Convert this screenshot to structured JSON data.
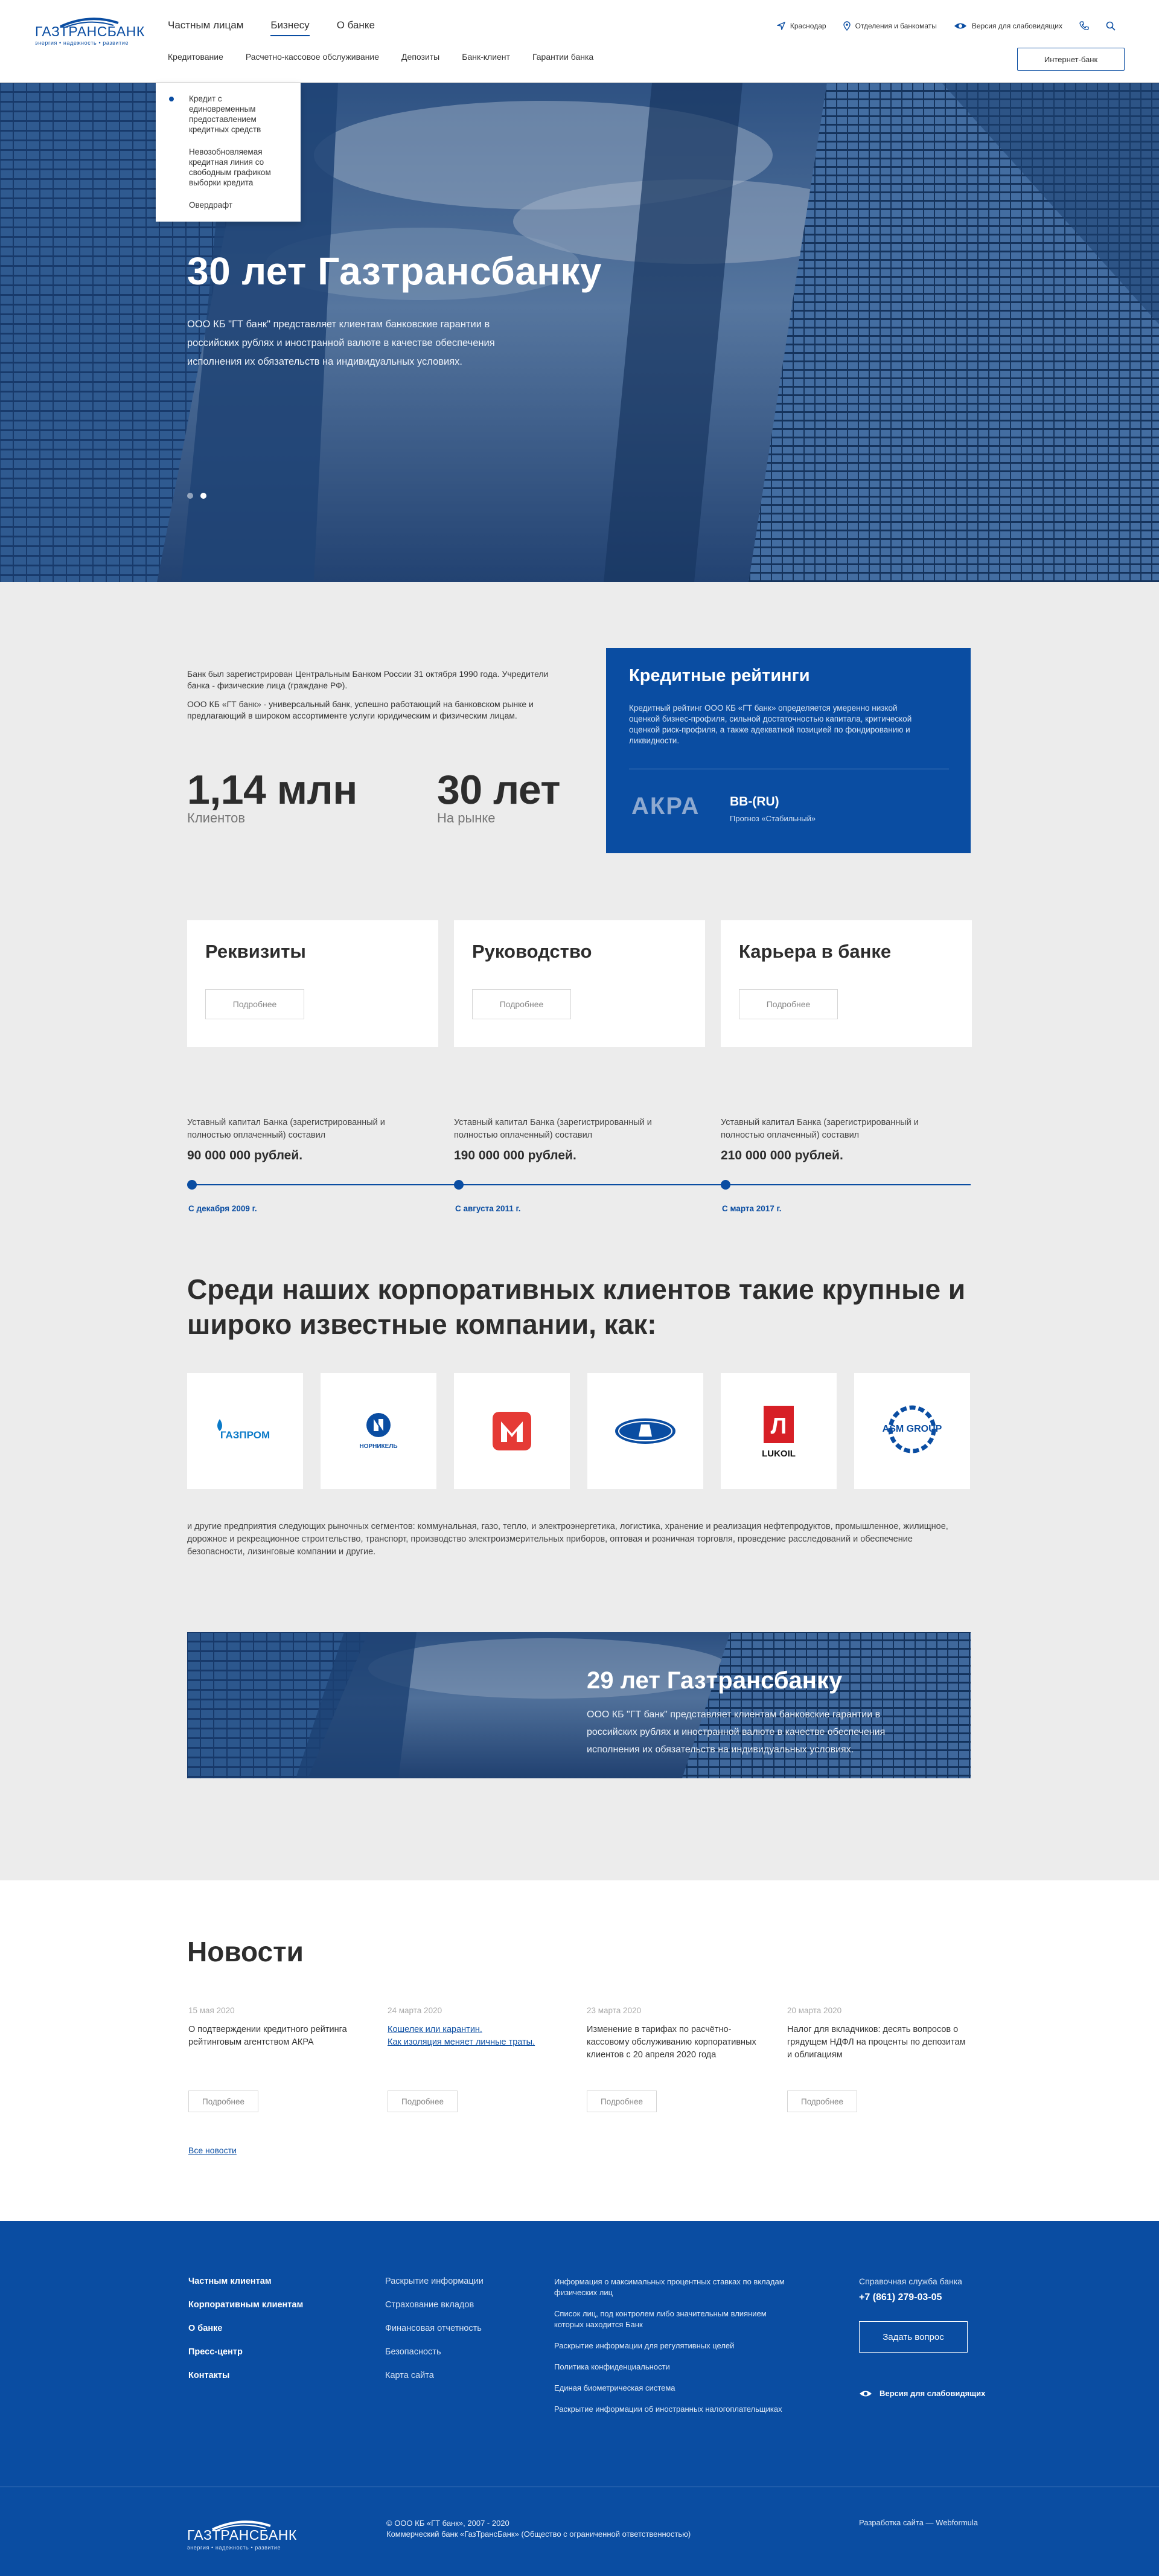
{
  "colors": {
    "brand_blue": "#0a4da2",
    "background": "#ececec"
  },
  "header": {
    "logo_name": "ГАЗТРАНСБАНК",
    "logo_tagline": "энергия • надежность • развитие",
    "top_nav": [
      "Частным лицам",
      "Бизнесу",
      "О банке"
    ],
    "sub_nav": [
      "Кредитование",
      "Расчетно-кассовое обслуживание",
      "Депозиты",
      "Банк-клиент",
      "Гарантии банка"
    ],
    "city": "Краснодар",
    "branches": "Отделения и банкоматы",
    "visually_impaired": "Версия для слабовидящих",
    "internet_bank": "Интернет-банк"
  },
  "dropdown": [
    "Кредит с единовременным предоставлением кредитных средств",
    "Невозобновляемая кредитная линия со свободным графиком выборки кредита",
    "Овердрафт"
  ],
  "hero": {
    "title": "30 лет Газтрансбанку",
    "text": "ООО КБ \"ГТ банк\" представляет клиентам банковские гарантии в российских рублях и иностранной валюте в качестве обеспечения исполнения их обязательств на индивидуальных условиях."
  },
  "about": {
    "p1": "Банк был зарегистрирован Центральным Банком России 31 октября 1990 года. Учредители банка - физические лица (граждане РФ).",
    "p2": "ООО КБ «ГТ банк» - универсальный банк, успешно работающий на банковском рынке и предлагающий в широком ассортименте услуги юридическим и физическим лицам.",
    "stat1_value": "1,14 млн",
    "stat1_label": "Клиентов",
    "stat2_value": "30 лет",
    "stat2_label": "На рынке"
  },
  "rating": {
    "title": "Кредитные рейтинги",
    "text": "Кредитный рейтинг ООО КБ «ГТ банк» определяется умеренно низкой оценкой бизнес-профиля, сильной достаточностью капитала, критической оценкой риск-профиля, а также адекватной позицией по фондированию и ликвидности.",
    "agency": "АКРА",
    "value": "BB-(RU)",
    "forecast": "Прогноз «Стабильный»"
  },
  "cards": [
    {
      "title": "Реквизиты",
      "button": "Подробнее"
    },
    {
      "title": "Руководство",
      "button": "Подробнее"
    },
    {
      "title": "Карьера в банке",
      "button": "Подробнее"
    }
  ],
  "timeline": [
    {
      "text": "Уставный капитал Банка (зарегистрированный и полностью оплаченный) составил",
      "value": "90 000 000 рублей.",
      "date": "С декабря 2009 г."
    },
    {
      "text": "Уставный капитал Банка (зарегистрированный и полностью оплаченный) составил",
      "value": "190 000 000 рублей.",
      "date": "С августа 2011 г."
    },
    {
      "text": "Уставный капитал Банка (зарегистрированный и полностью оплаченный) составил",
      "value": "210 000 000 рублей.",
      "date": "С марта 2017 г."
    }
  ],
  "clients": {
    "title": "Среди наших корпоративных клиентов такие крупные и широко известные компании, как:",
    "logos": [
      {
        "icon": "gazprom-logo",
        "label": "ГАЗПРОМ"
      },
      {
        "icon": "nornickel-logo",
        "label": "НОРНИКЕЛЬ"
      },
      {
        "icon": "magnit-logo",
        "label": ""
      },
      {
        "icon": "lada-logo",
        "label": ""
      },
      {
        "icon": "lukoil-logo",
        "label": "LUKOIL"
      },
      {
        "icon": "asm-group-logo",
        "label": "ASM GROUP"
      }
    ],
    "text": "и другие предприятия следующих рыночных сегментов: коммунальная, газо, тепло, и электроэнергетика, логистика, хранение и реализация нефтепродуктов, промышленное, жилищное, дорожное и рекреационное строительство, транспорт, производство электроизмерительных приборов, оптовая и розничная торговля, проведение расследований и обеспечение безопасности, лизинговые компании  и другие."
  },
  "banner": {
    "title": "29 лет Газтрансбанку",
    "text": "ООО КБ \"ГТ банк\" представляет клиентам банковские гарантии в российских рублях и иностранной валюте в качестве обеспечения исполнения их обязательств на индивидуальных условиях."
  },
  "news": {
    "title": "Новости",
    "items": [
      {
        "date": "15 мая 2020",
        "text": "О подтверждении кредитного рейтинга рейтинговым агентством АКРА",
        "button": "Подробнее"
      },
      {
        "date": "24 марта 2020",
        "link1": "Кошелек или карантин.",
        "link2": "Как изоляция меняет личные траты.",
        "button": "Подробнее"
      },
      {
        "date": "23 марта 2020",
        "text": "Изменение в тарифах по расчётно-кассовому обслуживанию корпоративных клиентов с 20 апреля 2020 года",
        "button": "Подробнее"
      },
      {
        "date": "20 марта 2020",
        "text": "Налог для вкладчиков: десять вопросов о грядущем НДФЛ на проценты по депозитам и облигациям",
        "button": "Подробнее"
      }
    ],
    "all": "Все новости"
  },
  "footer": {
    "col1": [
      "Частным клиентам",
      "Корпоративным клиентам",
      "О банке",
      "Пресс-центр",
      "Контакты"
    ],
    "col2": [
      "Раскрытие информации",
      "Страхование вкладов",
      "Финансовая отчетность",
      "Безопасность",
      "Карта сайта"
    ],
    "col3": [
      "Информация о максимальных процентных ставках по вкладам физических лиц",
      "Список лиц, под контролем либо значительным влиянием которых находится Банк",
      "Раскрытие информации для регулятивных целей",
      "Политика конфиденциальности",
      "Единая биометрическая система",
      "Раскрытие информации об иностранных налогоплательщиках"
    ],
    "help_title": "Справочная служба банка",
    "phone": "+7 (861) 279-03-05",
    "ask": "Задать вопрос",
    "visually_impaired": "Версия для слабовидящих",
    "logo_name": "ГАЗТРАНСБАНК",
    "logo_tagline": "энергия • надежность • развитие",
    "copyright": "© ООО КБ «ГТ банк», 2007 - 2020",
    "legal": "Коммерческий банк «ГазТрансБанк» (Общество с ограниченной ответственностью)",
    "developer": "Разработка сайта — Webformula"
  }
}
